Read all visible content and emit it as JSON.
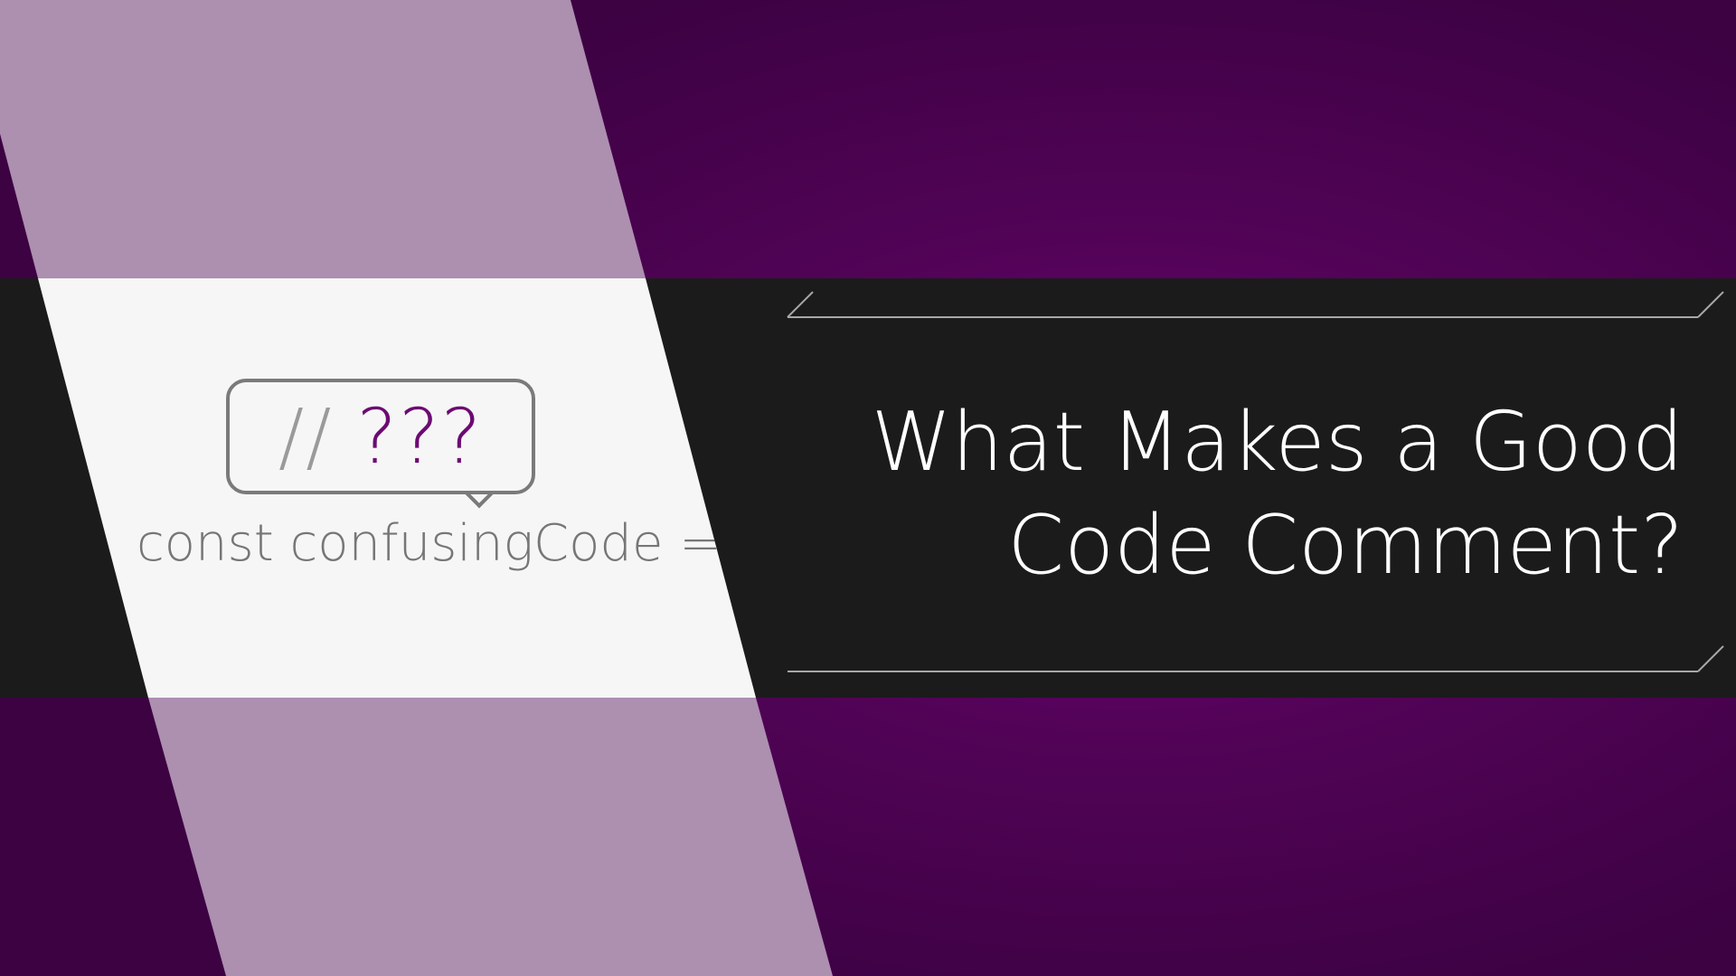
{
  "title": {
    "line1": "What Makes a Good",
    "line2": "Code Comment?"
  },
  "bubble": {
    "slashes": "//",
    "question": "???"
  },
  "code": {
    "text": "const confusingCode = f"
  },
  "colors": {
    "background_purple": "#5a0464",
    "band_dark": "#1b1b1b",
    "stripe_light": "#f6f6f6",
    "stripe_tint": "#ae8fb0",
    "accent_purple": "#6c0a72",
    "frame_line": "#a8a8a8"
  }
}
